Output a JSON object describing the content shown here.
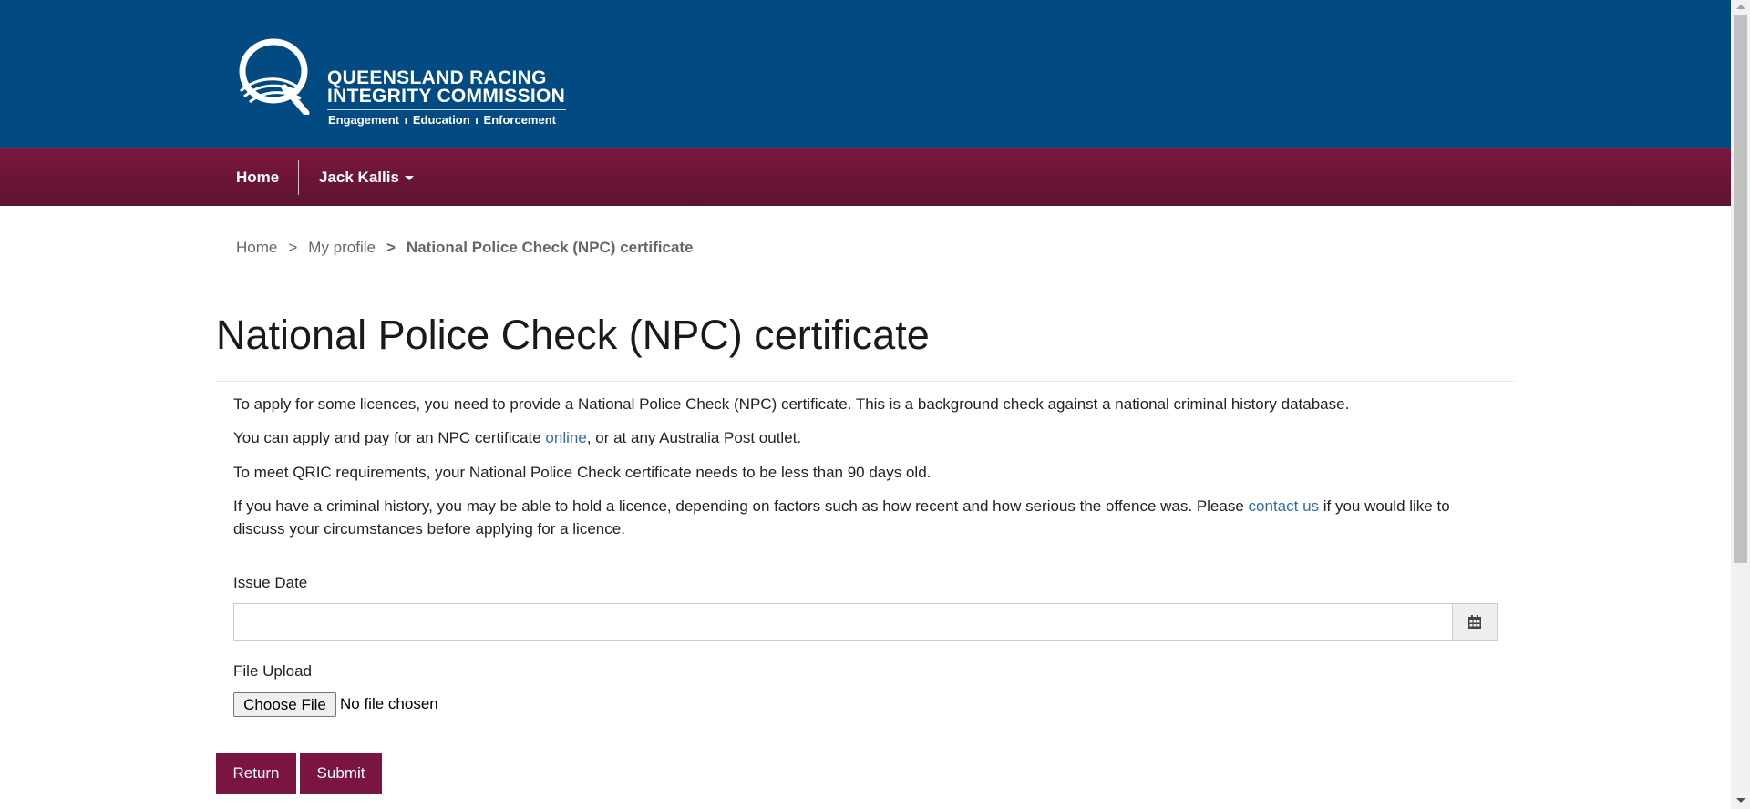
{
  "header": {
    "logo": {
      "line1": "QUEENSLAND RACING",
      "line2": "INTEGRITY COMMISSION",
      "tagline": "Engagement  ı  Education  ı  Enforcement",
      "icon": "qric-logo-icon"
    }
  },
  "nav": {
    "home": "Home",
    "user": "Jack Kallis"
  },
  "breadcrumb": {
    "items": [
      "Home",
      "My profile"
    ],
    "separator": ">",
    "current": "National Police Check (NPC) certificate"
  },
  "page": {
    "title": "National Police Check (NPC) certificate",
    "p1": "To apply for some licences, you need to provide a National Police Check (NPC) certificate. This is a background check against a national criminal history database.",
    "p2_before": "You can apply and pay for an NPC certificate ",
    "p2_link": "online",
    "p2_after": ", or at any Australia Post outlet.",
    "p3": "To meet QRIC requirements, your National Police Check certificate needs to be less than 90 days old.",
    "p4_before": "If you have a criminal history, you may be able to hold a licence, depending on factors such as how recent and how serious the offence was. Please ",
    "p4_link": "contact us",
    "p4_after": " if you would like to discuss your circumstances before applying for a licence."
  },
  "form": {
    "issue_date_label": "Issue Date",
    "issue_date_value": "",
    "calendar_icon": "calendar-icon",
    "file_upload_label": "File Upload",
    "choose_file": "Choose File",
    "file_status": "No file chosen"
  },
  "actions": {
    "return": "Return",
    "submit": "Submit"
  },
  "colors": {
    "header_bg": "#014a82",
    "nav_bg": "#6d1438",
    "button_bg": "#7a1440",
    "link": "#2f6ea3"
  }
}
